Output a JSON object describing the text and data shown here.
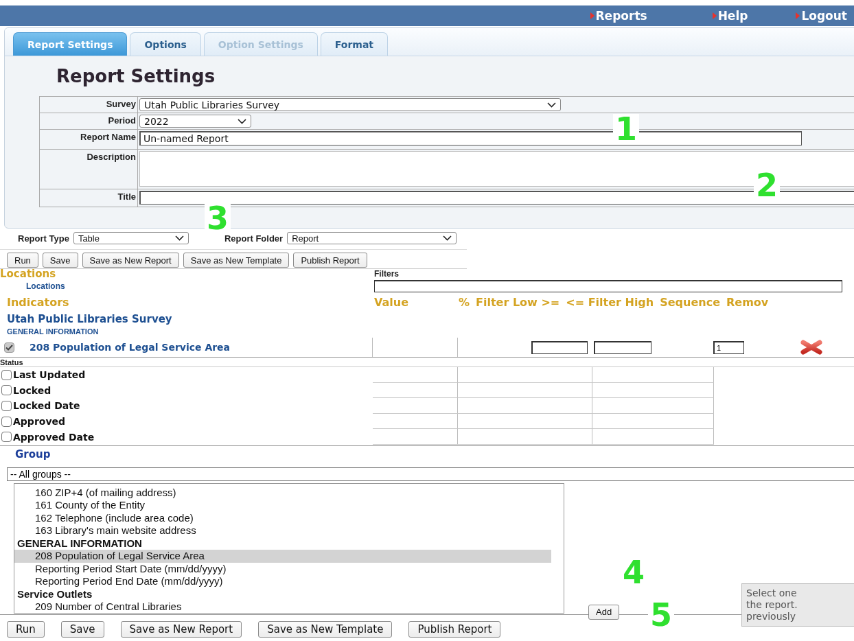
{
  "top_nav": [
    {
      "label": "Reports"
    },
    {
      "label": "Help"
    },
    {
      "label": "Logout"
    }
  ],
  "tabs": [
    {
      "label": "Report Settings",
      "selected": true,
      "disabled": false
    },
    {
      "label": "Options",
      "selected": false,
      "disabled": false
    },
    {
      "label": "Option Settings",
      "selected": false,
      "disabled": true
    },
    {
      "label": "Format",
      "selected": false,
      "disabled": false
    }
  ],
  "heading": "Report Settings",
  "form": {
    "fields": [
      {
        "label": "Survey",
        "kind": "select",
        "value": "Utah Public Libraries Survey"
      },
      {
        "label": "Period",
        "kind": "select",
        "value": "2022"
      },
      {
        "label": "Report Name",
        "kind": "text",
        "value": "Un-named Report"
      },
      {
        "label": "Description",
        "kind": "textarea"
      },
      {
        "label": "Title",
        "kind": "wide-text"
      }
    ]
  },
  "report_type": {
    "label": "Report Type",
    "value": "Table"
  },
  "report_folder": {
    "label": "Report Folder",
    "value": "Report"
  },
  "toolbar_buttons": [
    "Run",
    "Save",
    "Save as New Report",
    "Save as New Template",
    "Publish Report"
  ],
  "locations": {
    "title": "Locations",
    "item": "Locations",
    "filters_label": "Filters"
  },
  "indicators": {
    "columns": [
      "Indicators",
      "Value",
      "%",
      "Filter Low >=",
      "<= Filter High",
      "Sequence",
      "Remov"
    ],
    "survey": "Utah Public Libraries Survey",
    "section": "GENERAL INFORMATION",
    "rows": [
      {
        "label": "208 Population of Legal Service Area",
        "checked": true,
        "sequence": "1"
      }
    ],
    "status_title": "Status",
    "status_rows": [
      {
        "label": "Last Updated",
        "checked": false
      },
      {
        "label": "Locked",
        "checked": false
      },
      {
        "label": "Locked Date",
        "checked": false
      },
      {
        "label": "Approved",
        "checked": false
      },
      {
        "label": "Approved Date",
        "checked": false
      }
    ]
  },
  "group": {
    "title": "Group",
    "select": "-- All groups --",
    "list": [
      {
        "kind": "item",
        "label": "160 ZIP+4 (of mailing address)",
        "selected": false
      },
      {
        "kind": "item",
        "label": "161 County of the Entity",
        "selected": false
      },
      {
        "kind": "item",
        "label": "162 Telephone (include area code)",
        "selected": false
      },
      {
        "kind": "item",
        "label": "163 Library's main website address",
        "selected": false
      },
      {
        "kind": "header",
        "label": "GENERAL INFORMATION",
        "selected": false
      },
      {
        "kind": "item",
        "label": "208 Population of Legal Service Area",
        "selected": true
      },
      {
        "kind": "item",
        "label": "Reporting Period Start Date (mm/dd/yyyy)",
        "selected": false
      },
      {
        "kind": "item",
        "label": "Reporting Period End Date (mm/dd/yyyy)",
        "selected": false
      },
      {
        "kind": "header",
        "label": "Service Outlets",
        "selected": false
      },
      {
        "kind": "item",
        "label": "209 Number of Central Libraries",
        "selected": false
      }
    ],
    "add_button": "Add"
  },
  "tooltip": [
    "Select one",
    "the report.",
    "previously"
  ],
  "bottom_buttons": [
    "Run",
    "Save",
    "Save as New Report",
    "Save as New Template",
    "Publish Report"
  ],
  "annotations": [
    "1",
    "2",
    "3",
    "4",
    "5"
  ]
}
